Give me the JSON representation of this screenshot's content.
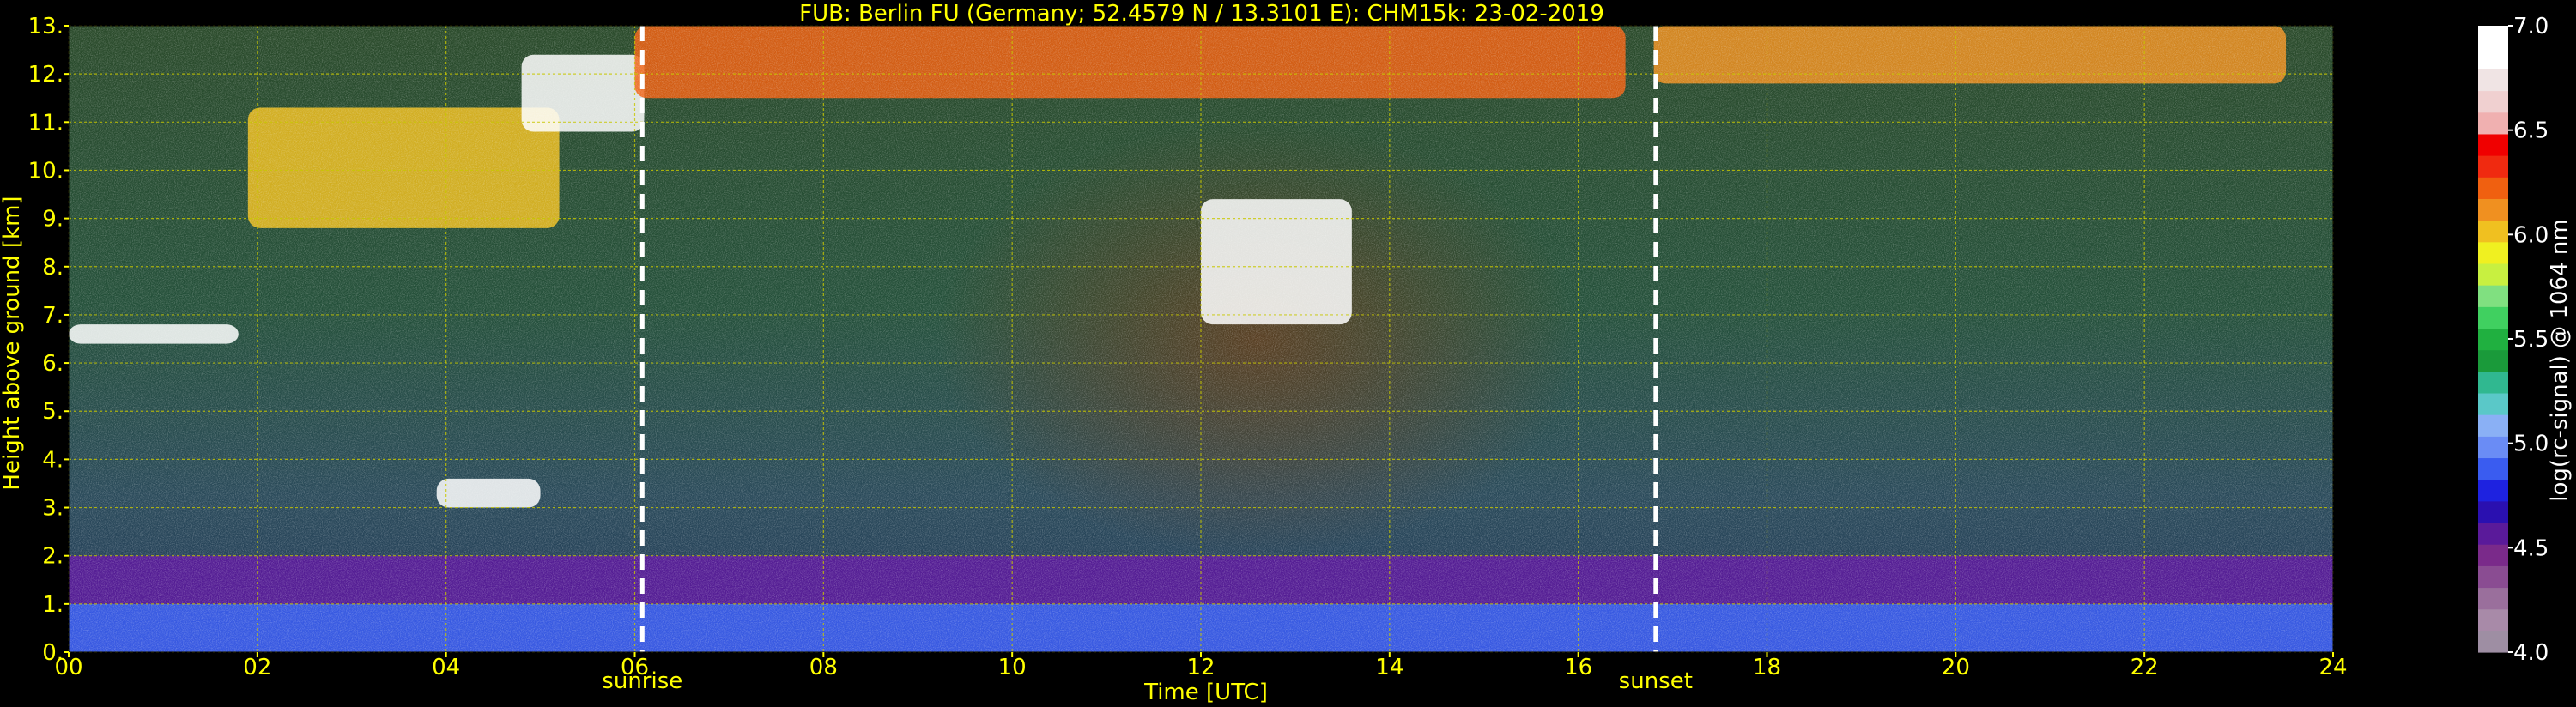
{
  "chart_data": {
    "type": "heatmap",
    "title": "FUB: Berlin FU (Germany; 52.4579 N / 13.3101 E):    CHM15k: 23-02-2019",
    "xlabel": "Time [UTC]",
    "ylabel": "Height above ground [km]",
    "xlim": [
      0,
      24
    ],
    "ylim": [
      0,
      13
    ],
    "x_ticks": [
      {
        "value": 0,
        "label": "00"
      },
      {
        "value": 2,
        "label": "02"
      },
      {
        "value": 4,
        "label": "04"
      },
      {
        "value": 6,
        "label": "06"
      },
      {
        "value": 8,
        "label": "08"
      },
      {
        "value": 10,
        "label": "10"
      },
      {
        "value": 12,
        "label": "12"
      },
      {
        "value": 14,
        "label": "14"
      },
      {
        "value": 16,
        "label": "16"
      },
      {
        "value": 18,
        "label": "18"
      },
      {
        "value": 20,
        "label": "20"
      },
      {
        "value": 22,
        "label": "22"
      },
      {
        "value": 24,
        "label": "24"
      }
    ],
    "y_ticks": [
      {
        "value": 0,
        "label": "0."
      },
      {
        "value": 1,
        "label": "1."
      },
      {
        "value": 2,
        "label": "2."
      },
      {
        "value": 3,
        "label": "3."
      },
      {
        "value": 4,
        "label": "4."
      },
      {
        "value": 5,
        "label": "5."
      },
      {
        "value": 6,
        "label": "6."
      },
      {
        "value": 7,
        "label": "7."
      },
      {
        "value": 8,
        "label": "8."
      },
      {
        "value": 9,
        "label": "9."
      },
      {
        "value": 10,
        "label": "10."
      },
      {
        "value": 11,
        "label": "11."
      },
      {
        "value": 12,
        "label": "12."
      },
      {
        "value": 13,
        "label": "13."
      }
    ],
    "grid": true,
    "markers": [
      {
        "x": 6.08,
        "label": "sunrise"
      },
      {
        "x": 16.82,
        "label": "sunset"
      }
    ],
    "colorbar": {
      "label": "log(rc-signal) @ 1064 nm",
      "range": [
        4.0,
        7.0
      ],
      "ticks": [
        {
          "value": 4.0,
          "label": "4.0"
        },
        {
          "value": 4.5,
          "label": "4.5"
        },
        {
          "value": 5.0,
          "label": "5.0"
        },
        {
          "value": 5.5,
          "label": "5.5"
        },
        {
          "value": 6.0,
          "label": "6.0"
        },
        {
          "value": 6.5,
          "label": "6.5"
        },
        {
          "value": 7.0,
          "label": "7.0"
        }
      ],
      "colors": [
        "#9e8ea3",
        "#a88aa8",
        "#9a6f9c",
        "#8a4c92",
        "#7a2a8a",
        "#5a1a9a",
        "#2a10b0",
        "#1e22e0",
        "#3a5cf0",
        "#6a8cf5",
        "#8ab0f5",
        "#5ac8c8",
        "#30b890",
        "#1a9a3a",
        "#20b040",
        "#40d060",
        "#80e080",
        "#c8f040",
        "#f0f020",
        "#f0c020",
        "#f09020",
        "#f06010",
        "#f02a10",
        "#f00000",
        "#f0b0b0",
        "#f0d0d0",
        "#f0e4e4",
        "#ffffff",
        "#ffffff"
      ]
    },
    "features": [
      {
        "name": "boundary_layer",
        "time": [
          0,
          24
        ],
        "height_km": [
          0,
          1.0
        ],
        "signal": 4.9
      },
      {
        "name": "residual_layer",
        "time": [
          0,
          24
        ],
        "height_km": [
          1.0,
          2.0
        ],
        "signal": 4.6
      },
      {
        "name": "mid_level_cloud",
        "time": [
          0,
          1.8
        ],
        "height_km": [
          6.4,
          6.8
        ],
        "signal": 6.8
      },
      {
        "name": "cirrus_early",
        "time": [
          1.9,
          5.2
        ],
        "height_km": [
          8.8,
          11.3
        ],
        "signal": 6.0
      },
      {
        "name": "cirrus_top",
        "time": [
          4.8,
          6.1
        ],
        "height_km": [
          10.8,
          12.4
        ],
        "signal": 6.9
      },
      {
        "name": "cirrus_upper",
        "time": [
          6,
          16.5
        ],
        "height_km": [
          11.5,
          13.0
        ],
        "signal": 6.2
      },
      {
        "name": "cirrus_midday",
        "time": [
          12.0,
          13.6
        ],
        "height_km": [
          6.8,
          9.4
        ],
        "signal": 6.9
      },
      {
        "name": "cirrus_late",
        "time": [
          16.8,
          23.5
        ],
        "height_km": [
          11.8,
          13.0
        ],
        "signal": 6.1
      },
      {
        "name": "thin_layer_early",
        "time": [
          3.9,
          5.0
        ],
        "height_km": [
          3.0,
          3.6
        ],
        "signal": 6.8
      }
    ]
  }
}
